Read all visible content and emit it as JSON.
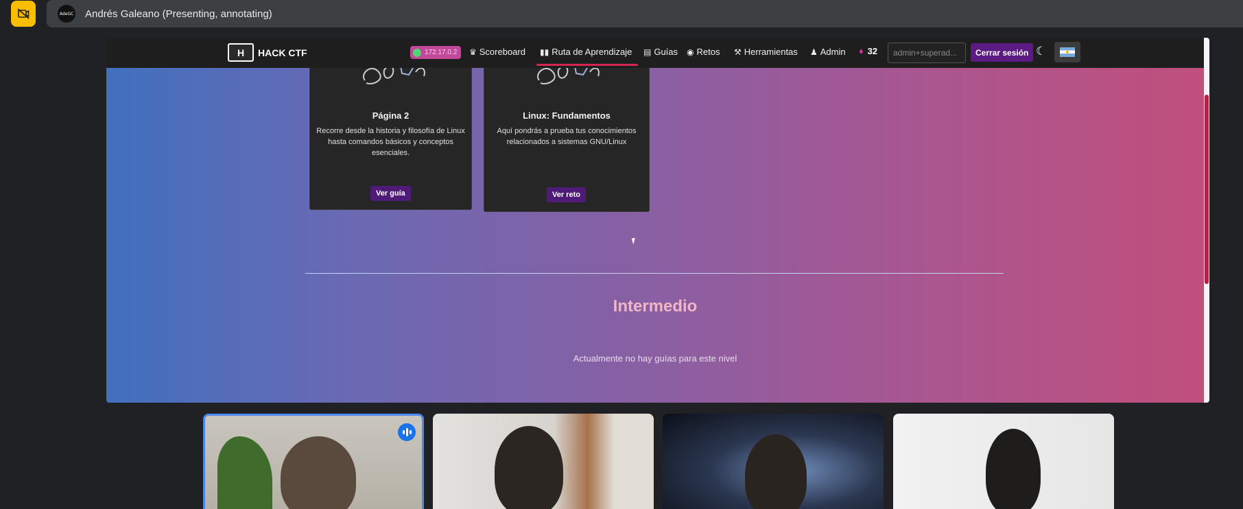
{
  "meet": {
    "presenter_title": "Andrés Galeano (Presenting, annotating)",
    "avatar_text": "AdeGC",
    "accent": "#fbbc04"
  },
  "site": {
    "brand": "HACK CTF",
    "brand_logo_letter": "H",
    "ip": "172.17.0.2",
    "nav": {
      "scoreboard": "Scoreboard",
      "ruta": "Ruta de Aprendizaje",
      "guias": "Guías",
      "retos": "Retos",
      "herramientas": "Herramientas",
      "admin": "Admin"
    },
    "points": "32",
    "user_field": "admin+superad...",
    "logout": "Cerrar sesión"
  },
  "cards": [
    {
      "title": "Página 2",
      "description": "Recorre desde la historia y filosofía de Linux hasta comandos básicos y conceptos esenciales.",
      "button": "Ver guía"
    },
    {
      "title": "Linux: Fundamentos",
      "description": "Aquí pondrás a prueba tus conocimientos relacionados a sistemas GNU/Linux",
      "button": "Ver reto"
    }
  ],
  "level": {
    "title": "Intermedio",
    "empty_message": "Actualmente no hay guías para este nivel"
  },
  "colors": {
    "nav_underline": "#d1264d",
    "button_purple": "#4f1b79",
    "ip_badge": "#c2489a",
    "gradient_start": "#4170be",
    "gradient_end": "#c04f7c"
  }
}
